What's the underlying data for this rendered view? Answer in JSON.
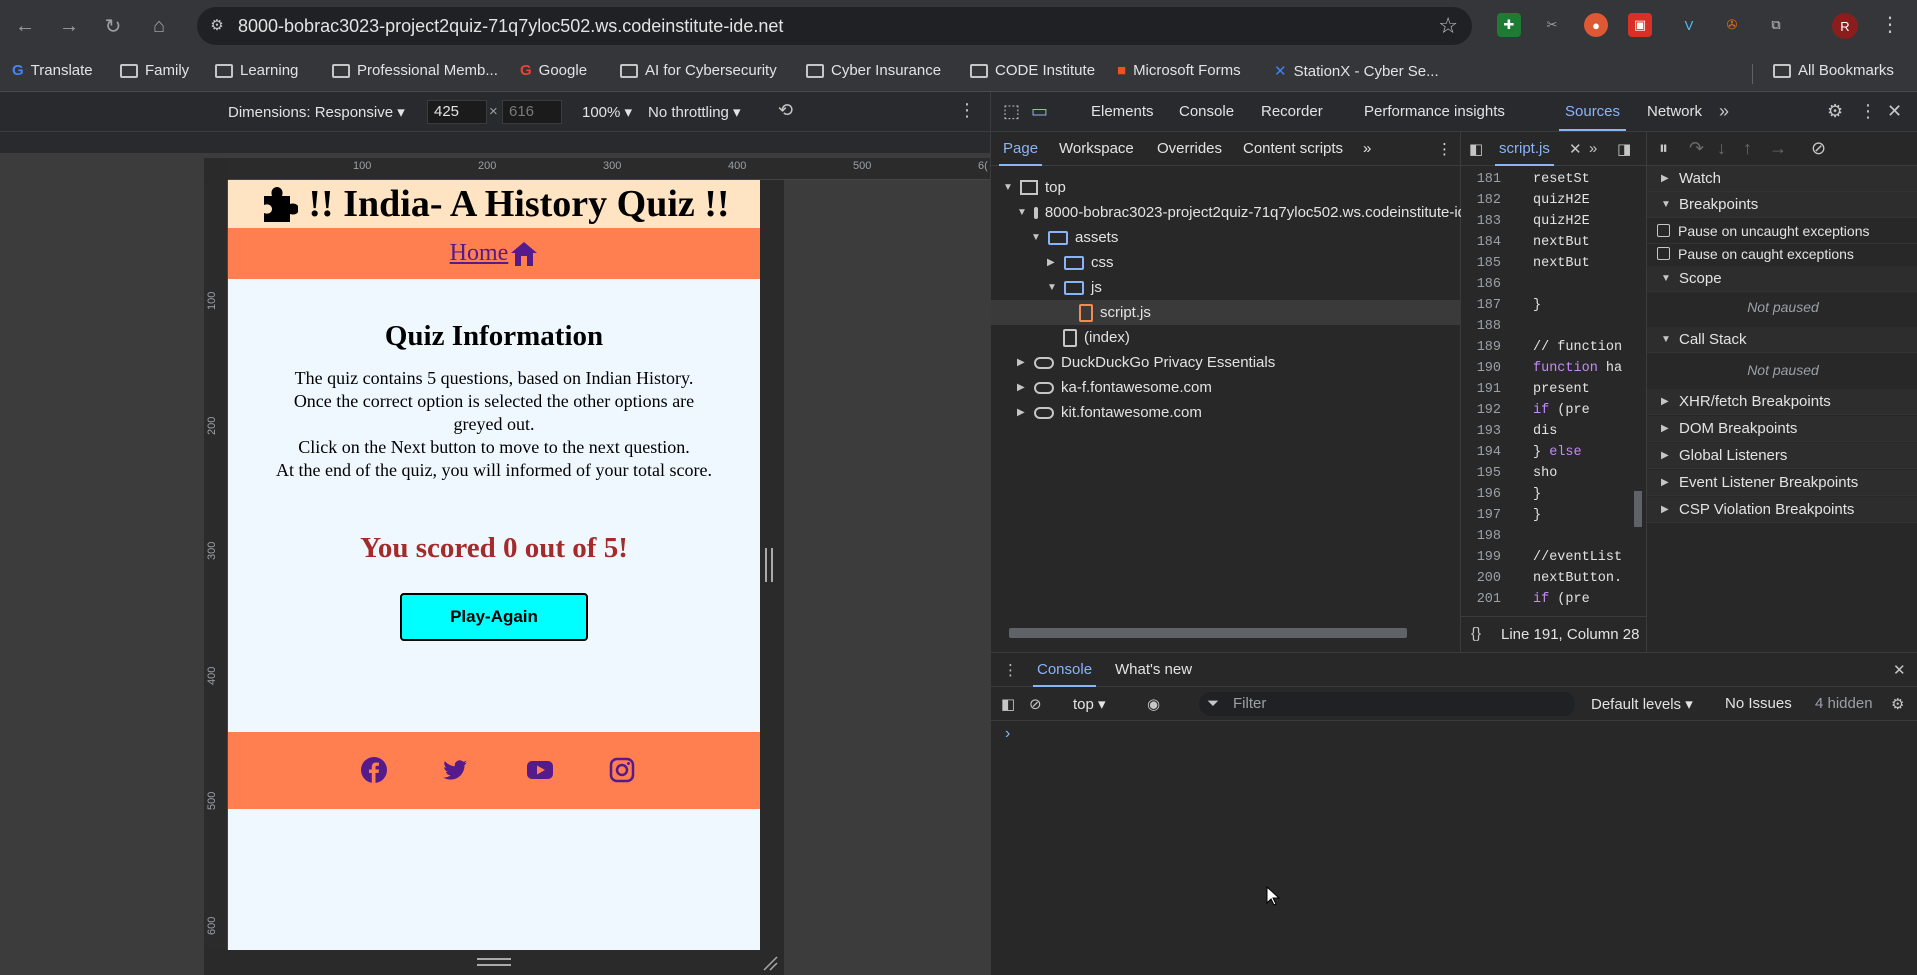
{
  "browser": {
    "url": "8000-bobrac3023-project2quiz-71q7yloc502.ws.codeinstitute-ide.net",
    "profile_initial": "R",
    "bookmarks": [
      "Translate",
      "Family",
      "Learning",
      "Professional Memb...",
      "Google",
      "AI for Cybersecurity",
      "Cyber Insurance",
      "CODE Institute",
      "Microsoft Forms",
      "StationX - Cyber Se..."
    ],
    "all_bookmarks": "All Bookmarks"
  },
  "device_toolbar": {
    "dimensions_label": "Dimensions: Responsive ▾",
    "width": "425",
    "x_sep": "×",
    "height": "616",
    "zoom": "100% ▾",
    "throttling": "No throttling ▾"
  },
  "rulers": {
    "h_ticks": [
      "100",
      "200",
      "300",
      "400",
      "500",
      "6("
    ],
    "v_ticks": [
      "100",
      "200",
      "300",
      "400",
      "500",
      "600"
    ]
  },
  "quiz": {
    "title": "!! India- A History Quiz !!",
    "home_link": "Home",
    "info_title": "Quiz Information",
    "info_lines": [
      "The quiz contains 5 questions, based on Indian History.",
      "Once the correct option is selected the other options are greyed out.",
      "Click on the Next button to move to the next question.",
      "At the end of the quiz, you will informed of your total score."
    ],
    "score": "You scored 0 out of 5!",
    "play_again": "Play-Again"
  },
  "devtools": {
    "main_tabs": [
      "Elements",
      "Console",
      "Recorder",
      "Performance insights",
      "Sources",
      "Network"
    ],
    "active_main_tab": "Sources",
    "nav_tabs": [
      "Page",
      "Workspace",
      "Overrides",
      "Content scripts"
    ],
    "tree": {
      "top": "top",
      "origin": "8000-bobrac3023-project2quiz-71q7yloc502.ws.codeinstitute-ide.net",
      "assets": "assets",
      "css": "css",
      "js": "js",
      "script": "script.js",
      "index": "(index)",
      "others": [
        "DuckDuckGo Privacy Essentials",
        "ka-f.fontawesome.com",
        "kit.fontawesome.com"
      ]
    },
    "editor_tab": "script.js",
    "code_lines": [
      {
        "ln": "181",
        "code": "    resetSt"
      },
      {
        "ln": "182",
        "code": "    quizH2E"
      },
      {
        "ln": "183",
        "code": "    quizH2E"
      },
      {
        "ln": "184",
        "code": "    nextBut"
      },
      {
        "ln": "185",
        "code": "    nextBut"
      },
      {
        "ln": "186",
        "code": ""
      },
      {
        "ln": "187",
        "code": "}"
      },
      {
        "ln": "188",
        "code": ""
      },
      {
        "ln": "189",
        "code": "// function"
      },
      {
        "ln": "190",
        "code": "function ha"
      },
      {
        "ln": "191",
        "code": "    present"
      },
      {
        "ln": "192",
        "code": "    if (pre"
      },
      {
        "ln": "193",
        "code": "        dis"
      },
      {
        "ln": "194",
        "code": "    } else"
      },
      {
        "ln": "195",
        "code": "        sho"
      },
      {
        "ln": "196",
        "code": "    }"
      },
      {
        "ln": "197",
        "code": "}"
      },
      {
        "ln": "198",
        "code": ""
      },
      {
        "ln": "199",
        "code": "//eventList"
      },
      {
        "ln": "200",
        "code": "nextButton."
      },
      {
        "ln": "201",
        "code": "    if (pre"
      }
    ],
    "status": "Line 191, Column 28",
    "debug": {
      "watch": "Watch",
      "breakpoints": "Breakpoints",
      "pause_uncaught": "Pause on uncaught exceptions",
      "pause_caught": "Pause on caught exceptions",
      "scope": "Scope",
      "scope_state": "Not paused",
      "call_stack": "Call Stack",
      "call_stack_state": "Not paused",
      "sections": [
        "XHR/fetch Breakpoints",
        "DOM Breakpoints",
        "Global Listeners",
        "Event Listener Breakpoints",
        "CSP Violation Breakpoints"
      ]
    },
    "drawer_tabs": [
      "Console",
      "What's new"
    ],
    "console": {
      "context": "top ▾",
      "filter_placeholder": "Filter",
      "levels": "Default levels ▾",
      "issues": "No Issues",
      "hidden": "4 hidden",
      "prompt": "›"
    }
  }
}
